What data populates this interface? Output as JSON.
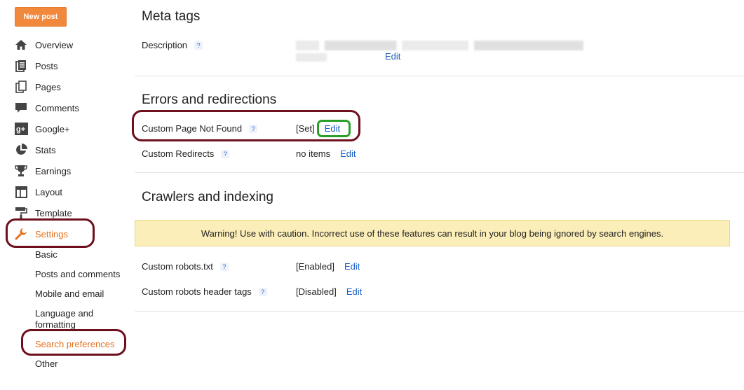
{
  "sidebar": {
    "new_post": "New post",
    "nav": [
      {
        "label": "Overview",
        "icon": "home-icon"
      },
      {
        "label": "Posts",
        "icon": "posts-icon"
      },
      {
        "label": "Pages",
        "icon": "pages-icon"
      },
      {
        "label": "Comments",
        "icon": "comment-icon"
      },
      {
        "label": "Google+",
        "icon": "google-plus-icon"
      },
      {
        "label": "Stats",
        "icon": "pie-chart-icon"
      },
      {
        "label": "Earnings",
        "icon": "trophy-icon"
      },
      {
        "label": "Layout",
        "icon": "layout-icon"
      },
      {
        "label": "Template",
        "icon": "paint-roller-icon"
      },
      {
        "label": "Settings",
        "icon": "wrench-icon"
      }
    ],
    "settings_sub": [
      "Basic",
      "Posts and comments",
      "Mobile and email",
      "Language and formatting",
      "Search preferences",
      "Other"
    ]
  },
  "meta": {
    "title": "Meta tags",
    "description_label": "Description",
    "description_edit": "Edit"
  },
  "errors": {
    "title": "Errors and redirections",
    "not_found_label": "Custom Page Not Found",
    "not_found_value": "[Set]",
    "not_found_edit": "Edit",
    "redirects_label": "Custom Redirects",
    "redirects_value": "no items",
    "redirects_edit": "Edit"
  },
  "crawlers": {
    "title": "Crawlers and indexing",
    "warning": "Warning! Use with caution. Incorrect use of these features can result in your blog being ignored by search engines.",
    "robots_label": "Custom robots.txt",
    "robots_value": "[Enabled]",
    "robots_edit": "Edit",
    "header_tags_label": "Custom robots header tags",
    "header_tags_value": "[Disabled]",
    "header_tags_edit": "Edit"
  },
  "help_glyph": "?",
  "colors": {
    "accent": "#e5711f",
    "link": "#1a5ec5",
    "annotation": "#6d0f1c",
    "highlight": "#2aa02a",
    "warning_bg": "#fbeeb8"
  }
}
